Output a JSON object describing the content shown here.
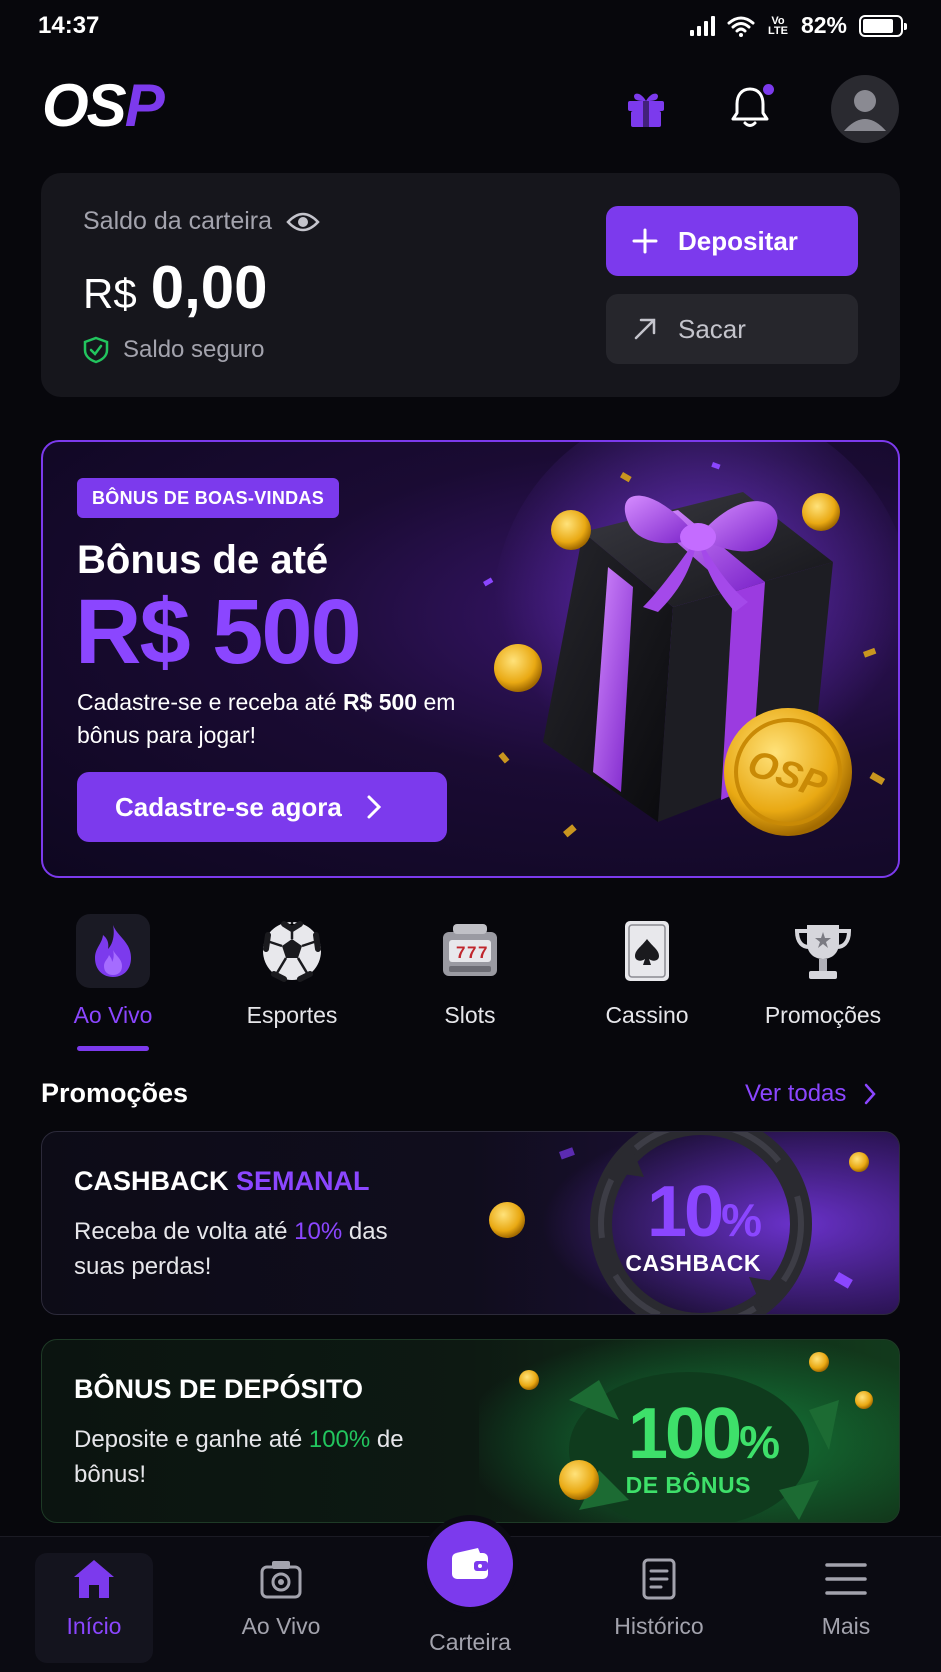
{
  "status_bar": {
    "time": "14:37",
    "network": "Vo LTE",
    "battery": "82%",
    "battery_level": 0.82
  },
  "header": {
    "logo": "OSP",
    "icons": [
      "gift-icon",
      "bell-icon",
      "avatar-icon"
    ],
    "has_notification": true
  },
  "wallet": {
    "label": "Saldo da carteira",
    "currency": "R$",
    "amount": "0,00",
    "safe_label": "Saldo seguro",
    "deposit_label": "Depositar",
    "withdraw_label": "Sacar"
  },
  "hero": {
    "badge": "BÔNUS DE BOAS-VINDAS",
    "title": "Bônus de até",
    "amount": "R$ 500",
    "desc_part1": "Cadastre-se e receba até ",
    "desc_bold": "R$ 500",
    "desc_part2": " em bônus para jogar!",
    "cta": "Cadastre-se agora",
    "coin_text": "OSP"
  },
  "categories": [
    {
      "label": "Ao Vivo",
      "icon": "fire-icon",
      "active": true
    },
    {
      "label": "Esportes",
      "icon": "soccer-ball-icon",
      "active": false
    },
    {
      "label": "Slots",
      "icon": "slot-machine-icon",
      "active": false
    },
    {
      "label": "Cassino",
      "icon": "playing-card-icon",
      "active": false
    },
    {
      "label": "Promoções",
      "icon": "trophy-icon",
      "active": false
    }
  ],
  "promotions": {
    "title": "Promoções",
    "see_all": "Ver todas",
    "cards": [
      {
        "title_main": "CASHBACK ",
        "title_accent": "SEMANAL",
        "desc_part1": "Receba de volta até ",
        "desc_highlight": "10%",
        "desc_part2": " das suas perdas!",
        "big_value": "10",
        "big_pct": "%",
        "big_sub": "CASHBACK"
      },
      {
        "title_main": "BÔNUS DE DEPÓSITO",
        "desc_part1": "Deposite e ganhe até ",
        "desc_highlight": "100%",
        "desc_part2": " de bônus!",
        "big_value": "100",
        "big_pct": "%",
        "big_sub": "DE BÔNUS"
      }
    ]
  },
  "bottom_nav": {
    "items": [
      {
        "label": "Início",
        "icon": "home-icon",
        "active": true
      },
      {
        "label": "Ao Vivo",
        "icon": "live-camera-icon",
        "active": false
      },
      {
        "label": "Carteira",
        "icon": "wallet-icon",
        "active": false
      },
      {
        "label": "Histórico",
        "icon": "history-icon",
        "active": false
      },
      {
        "label": "Mais",
        "icon": "menu-icon",
        "active": false
      }
    ]
  },
  "colors": {
    "accent": "#7c3aed",
    "accent_light": "#8b46ff",
    "green": "#22c55e",
    "background": "#07070c",
    "card": "#16161c"
  }
}
